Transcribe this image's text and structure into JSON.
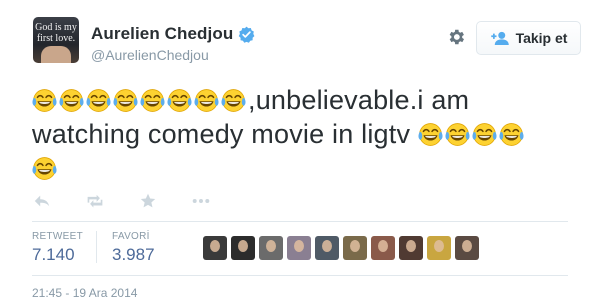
{
  "user": {
    "avatar_text_line1": "God is my",
    "avatar_text_line2": "first love.",
    "name": "Aurelien Chedjou",
    "handle": "@AurelienChedjou",
    "verified": true
  },
  "header": {
    "follow_label": "Takip et",
    "settings_icon": "gear-icon"
  },
  "tweet": {
    "line1_text": ",unbelievable.i am",
    "line2_text": "watching comedy movie in ligtv",
    "emoji": "face-with-tears-of-joy",
    "line1_emoji_count": 8,
    "line2_emoji_count": 4,
    "line3_emoji_count": 1
  },
  "actions": [
    {
      "icon": "reply-icon"
    },
    {
      "icon": "retweet-icon"
    },
    {
      "icon": "favorite-star-icon"
    },
    {
      "icon": "more-icon"
    }
  ],
  "stats": {
    "retweet_label": "RETWEET",
    "retweet_count": "7.140",
    "favorite_label": "FAVORİ",
    "favorite_count": "3.987"
  },
  "timestamp": "21:45 - 19 Ara 2014",
  "colors": {
    "text": "#292f33",
    "muted": "#8899a6",
    "link_stat": "#4d6a99",
    "verified": "#55acee",
    "border": "#e1e8ed",
    "emoji_face": "#fdd231"
  },
  "favoriters": [
    {
      "bg": "#3a3a3a"
    },
    {
      "bg": "#2c2c2c"
    },
    {
      "bg": "#6b6b6b"
    },
    {
      "bg": "#8a7f92"
    },
    {
      "bg": "#4f5a66"
    },
    {
      "bg": "#7a6a4a"
    },
    {
      "bg": "#8a5a4a"
    },
    {
      "bg": "#503a32"
    },
    {
      "bg": "#c9a640"
    },
    {
      "bg": "#5a4a42"
    }
  ]
}
